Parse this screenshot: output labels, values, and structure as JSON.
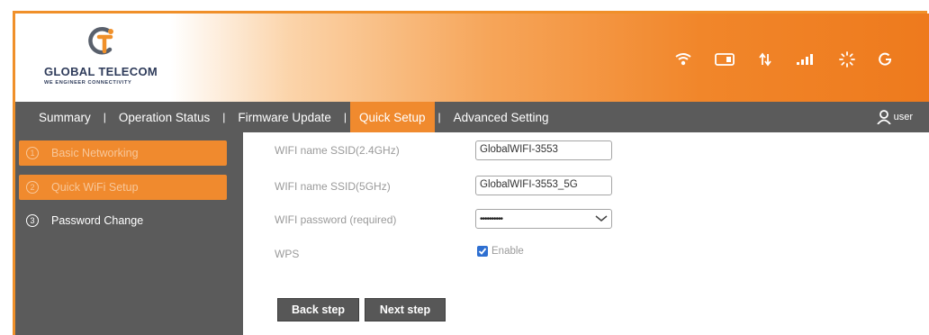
{
  "brand": {
    "name": "GLOBAL TELECOM",
    "tagline": "WE ENGINEER CONNECTIVITY",
    "accent_color": "#f08a2e"
  },
  "status_icons": [
    "wifi-icon",
    "sim-card-icon",
    "data-transfer-icon",
    "signal-strength-icon",
    "sun-icon",
    "power-icon"
  ],
  "nav": {
    "items": [
      {
        "label": "Summary"
      },
      {
        "label": "Operation Status"
      },
      {
        "label": "Firmware Update"
      },
      {
        "label": "Quick Setup",
        "active": true
      },
      {
        "label": "Advanced Setting"
      }
    ],
    "user_label": "user"
  },
  "sidebar": {
    "items": [
      {
        "number": "1",
        "label": "Basic Networking",
        "highlighted": true
      },
      {
        "number": "2",
        "label": "Quick WiFi Setup",
        "highlighted": true
      },
      {
        "number": "3",
        "label": "Password Change",
        "highlighted": false
      }
    ]
  },
  "form": {
    "ssid_24": {
      "label": "WIFI name SSID(2.4GHz)",
      "value": "GlobalWIFI-3553"
    },
    "ssid_5": {
      "label": "WIFI name SSID(5GHz)",
      "value": "GlobalWIFI-3553_5G"
    },
    "password": {
      "label": "WIFI password (required)",
      "value": "••••••••••"
    },
    "wps": {
      "label": "WPS",
      "checkbox_label": "Enable",
      "checked": true
    }
  },
  "buttons": {
    "back": "Back step",
    "next": "Next step"
  }
}
